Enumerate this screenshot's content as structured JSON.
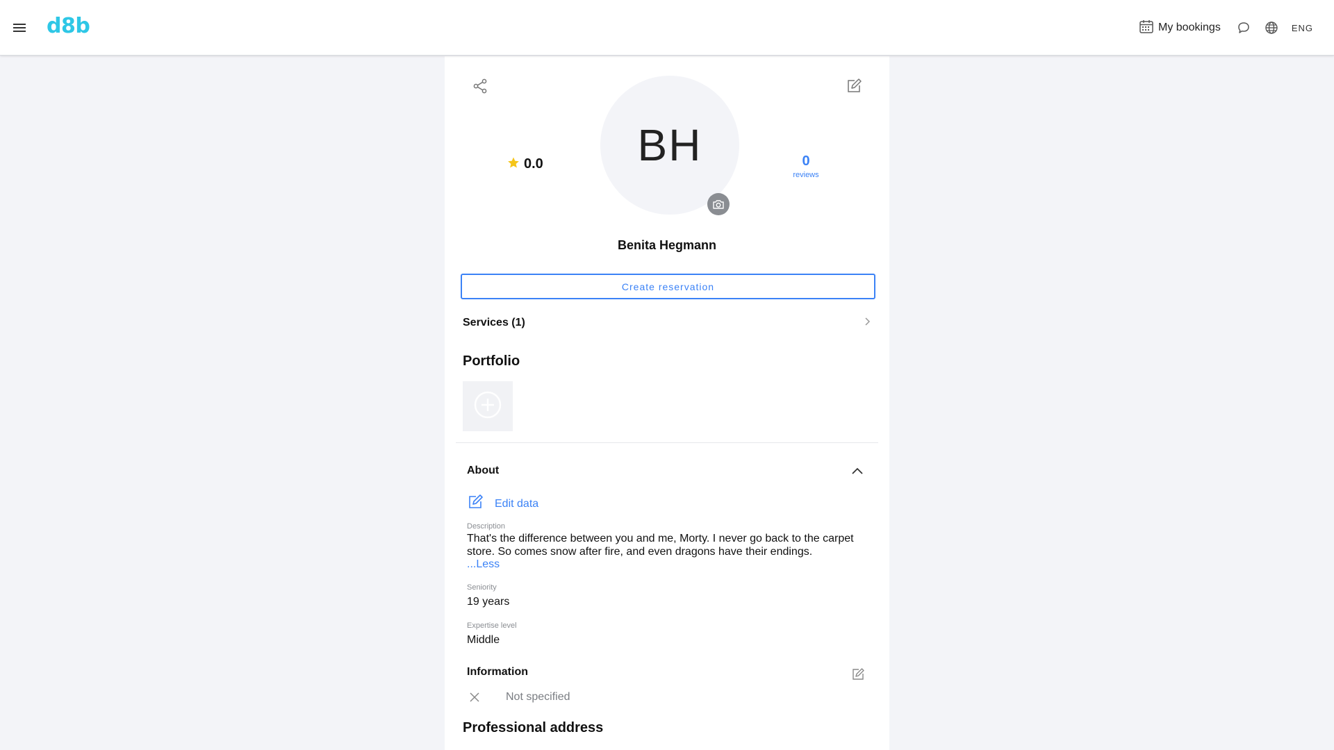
{
  "header": {
    "logo": "d8b",
    "my_bookings": "My bookings",
    "language": "ENG"
  },
  "profile": {
    "initials": "BH",
    "rating": "0.0",
    "reviews_count": "0",
    "reviews_label": "reviews",
    "name": "Benita Hegmann"
  },
  "actions": {
    "create_reservation": "Create reservation"
  },
  "services": {
    "label": "Services (1)"
  },
  "portfolio": {
    "title": "Portfolio"
  },
  "about": {
    "title": "About",
    "edit_data": "Edit data",
    "description_label": "Description",
    "description": "That's the difference between you and me, Morty. I never go back to the carpet store. So comes snow after fire, and even dragons have their endings.",
    "less_link": "...Less",
    "seniority_label": "Seniority",
    "seniority": "19 years",
    "expertise_label": "Expertise level",
    "expertise": "Middle"
  },
  "information": {
    "title": "Information",
    "value": "Not specified"
  },
  "professional_address": {
    "title": "Professional address"
  },
  "colors": {
    "accent": "#3b82f6",
    "logo": "#2ec7e6",
    "star": "#f5c518",
    "background": "#f3f4f8"
  },
  "icons": [
    "menu-icon",
    "calendar-icon",
    "chat-icon",
    "globe-icon",
    "share-icon",
    "edit-icon",
    "star-icon",
    "camera-icon",
    "chevron-right-icon",
    "add-circle-icon",
    "chevron-up-icon",
    "close-icon"
  ]
}
